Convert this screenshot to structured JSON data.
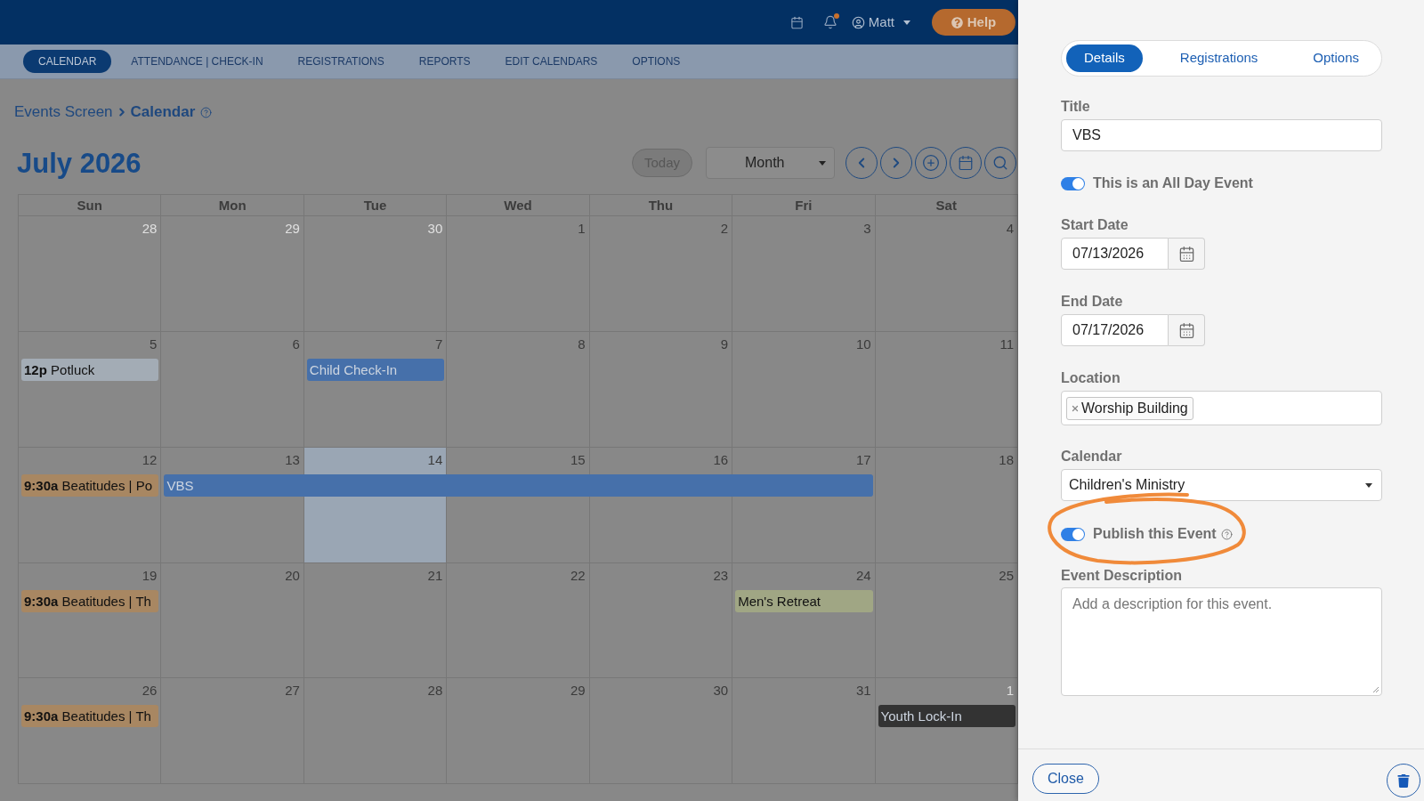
{
  "top_bar": {
    "has_notification": true,
    "user_name": "Matt",
    "help_button": "Help"
  },
  "nav_tabs": [
    {
      "label": "CALENDAR",
      "selected": true
    },
    {
      "label": "ATTENDANCE | CHECK-IN",
      "selected": false
    },
    {
      "label": "REGISTRATIONS",
      "selected": false
    },
    {
      "label": "REPORTS",
      "selected": false
    },
    {
      "label": "EDIT CALENDARS",
      "selected": false
    },
    {
      "label": "OPTIONS",
      "selected": false
    }
  ],
  "breadcrumb": {
    "parent": "Events Screen",
    "current": "Calendar"
  },
  "calendar": {
    "title": "July 2026",
    "today_button": {
      "label": "Today",
      "disabled": true
    },
    "view_select": "Month",
    "weekdays": [
      "Sun",
      "Mon",
      "Tue",
      "Wed",
      "Thu",
      "Fri",
      "Sat"
    ],
    "weeks": [
      {
        "days": [
          {
            "number": "28",
            "other_month": true,
            "today": false
          },
          {
            "number": "29",
            "other_month": true,
            "today": false
          },
          {
            "number": "30",
            "other_month": true,
            "today": false
          },
          {
            "number": "1",
            "other_month": false,
            "today": false
          },
          {
            "number": "2",
            "other_month": false,
            "today": false
          },
          {
            "number": "3",
            "other_month": false,
            "today": false
          },
          {
            "number": "4",
            "other_month": false,
            "today": false
          }
        ]
      },
      {
        "days": [
          {
            "number": "5",
            "other_month": false,
            "today": false,
            "events": [
              {
                "kind": "event",
                "time": "12p",
                "title": "Potluck",
                "color": "#a3acb5"
              }
            ]
          },
          {
            "number": "6",
            "other_month": false,
            "today": false
          },
          {
            "number": "7",
            "other_month": false,
            "today": false,
            "events": [
              {
                "kind": "event",
                "title": "Child Check-In",
                "color": "#4670aa"
              }
            ]
          },
          {
            "number": "8",
            "other_month": false,
            "today": false
          },
          {
            "number": "9",
            "other_month": false,
            "today": false
          },
          {
            "number": "10",
            "other_month": false,
            "today": false
          },
          {
            "number": "11",
            "other_month": false,
            "today": false
          }
        ]
      },
      {
        "days": [
          {
            "number": "12",
            "other_month": false,
            "today": false,
            "events": [
              {
                "kind": "event",
                "time": "9:30a",
                "title": "Beatitudes | Po",
                "color": "#a88762"
              }
            ]
          },
          {
            "number": "13",
            "other_month": false,
            "today": false,
            "events": [
              {
                "kind": "event",
                "title": "VBS",
                "color": "#4670aa"
              }
            ]
          },
          {
            "number": "14",
            "other_month": false,
            "today": true,
            "events": [
              {
                "kind": "continuation"
              }
            ]
          },
          {
            "number": "15",
            "other_month": false,
            "today": false,
            "events": [
              {
                "kind": "continuation"
              }
            ]
          },
          {
            "number": "16",
            "other_month": false,
            "today": false,
            "events": [
              {
                "kind": "continuation"
              }
            ]
          },
          {
            "number": "17",
            "other_month": false,
            "today": false,
            "events": [
              {
                "kind": "continuation"
              }
            ]
          },
          {
            "number": "18",
            "other_month": false,
            "today": false
          }
        ]
      },
      {
        "days": [
          {
            "number": "19",
            "other_month": false,
            "today": false,
            "events": [
              {
                "kind": "event",
                "time": "9:30a",
                "title": "Beatitudes | Th",
                "color": "#a88762"
              }
            ]
          },
          {
            "number": "20",
            "other_month": false,
            "today": false
          },
          {
            "number": "21",
            "other_month": false,
            "today": false
          },
          {
            "number": "22",
            "other_month": false,
            "today": false
          },
          {
            "number": "23",
            "other_month": false,
            "today": false
          },
          {
            "number": "24",
            "other_month": false,
            "today": false,
            "events": [
              {
                "kind": "event",
                "title": "Men's Retreat",
                "color": "#a0a684"
              }
            ]
          },
          {
            "number": "25",
            "other_month": false,
            "today": false
          }
        ]
      },
      {
        "days": [
          {
            "number": "26",
            "other_month": false,
            "today": false,
            "events": [
              {
                "kind": "event",
                "time": "9:30a",
                "title": "Beatitudes | Th",
                "color": "#a88762"
              }
            ]
          },
          {
            "number": "27",
            "other_month": false,
            "today": false
          },
          {
            "number": "28",
            "other_month": false,
            "today": false
          },
          {
            "number": "29",
            "other_month": false,
            "today": false
          },
          {
            "number": "30",
            "other_month": false,
            "today": false
          },
          {
            "number": "31",
            "other_month": false,
            "today": false
          },
          {
            "number": "1",
            "other_month": true,
            "today": false,
            "events": [
              {
                "kind": "event",
                "title": "Youth Lock-In",
                "color": "#333333"
              }
            ]
          }
        ]
      }
    ]
  },
  "event_panel": {
    "tabs": [
      {
        "label": "Details",
        "selected": true
      },
      {
        "label": "Registrations",
        "selected": false
      },
      {
        "label": "Options",
        "selected": false
      }
    ],
    "title": {
      "label": "Title",
      "value": "VBS"
    },
    "all_day": {
      "label": "This is an All Day Event",
      "on": true
    },
    "start_date": {
      "label": "Start Date",
      "value": "07/13/2026"
    },
    "end_date": {
      "label": "End Date",
      "value": "07/17/2026"
    },
    "location": {
      "label": "Location",
      "tags": [
        "Worship Building"
      ]
    },
    "calendar": {
      "label": "Calendar",
      "value": "Children's Ministry"
    },
    "publish": {
      "label": "Publish this Event",
      "on": true
    },
    "description": {
      "label": "Event Description",
      "placeholder": "Add a description for this event."
    },
    "close_button": "Close"
  }
}
